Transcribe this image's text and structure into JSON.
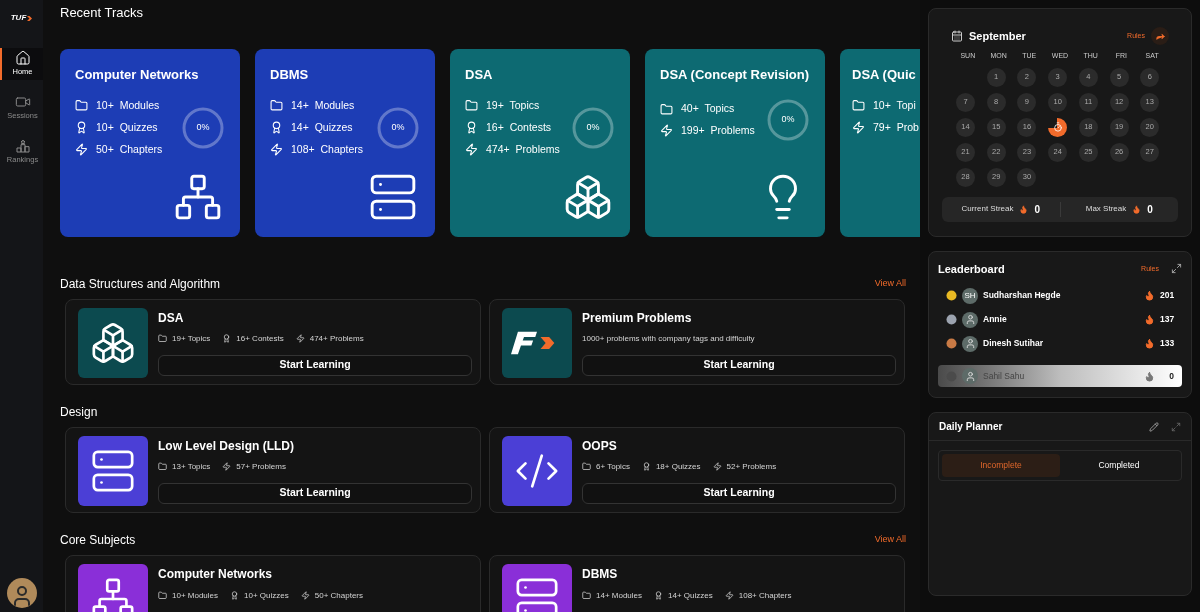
{
  "sidebar": {
    "logo": "TUF",
    "items": [
      {
        "label": "Home",
        "selected": true
      },
      {
        "label": "Sessions",
        "selected": false
      },
      {
        "label": "Rankings",
        "selected": false
      }
    ]
  },
  "recent_tracks": {
    "title": "Recent Tracks",
    "cards": [
      {
        "title": "Computer Networks",
        "color": "#1d3db5",
        "kind": "network",
        "progress": "0%",
        "level": 0,
        "stats": [
          {
            "kind": "folder",
            "value": "10+",
            "label": "Modules"
          },
          {
            "kind": "award",
            "value": "10+",
            "label": "Quizzes"
          },
          {
            "kind": "bolt",
            "value": "50+",
            "label": "Chapters"
          }
        ]
      },
      {
        "title": "DBMS",
        "color": "#1d3db5",
        "kind": "server",
        "progress": "0%",
        "level": 0,
        "stats": [
          {
            "kind": "folder",
            "value": "14+",
            "label": "Modules"
          },
          {
            "kind": "award",
            "value": "14+",
            "label": "Quizzes"
          },
          {
            "kind": "bolt",
            "value": "108+",
            "label": "Chapters"
          }
        ]
      },
      {
        "title": "DSA",
        "color": "#0d6a72",
        "kind": "cubes",
        "progress": "0%",
        "level": 0,
        "stats": [
          {
            "kind": "folder",
            "value": "19+",
            "label": "Topics"
          },
          {
            "kind": "award",
            "value": "16+",
            "label": "Contests"
          },
          {
            "kind": "bolt",
            "value": "474+",
            "label": "Problems"
          }
        ]
      },
      {
        "title": "DSA (Concept Revision)",
        "color": "#0d6a72",
        "kind": "bulb",
        "progress": "0%",
        "level": 0,
        "stats": [
          {
            "kind": "folder",
            "value": "40+",
            "label": "Topics"
          },
          {
            "kind": "bolt",
            "value": "199+",
            "label": "Problems"
          }
        ]
      },
      {
        "title": "DSA (Quic",
        "color": "#0d6a72",
        "stats": [
          {
            "kind": "folder",
            "value": "10+",
            "label": "Topi"
          },
          {
            "kind": "bolt",
            "value": "79+",
            "label": "Prob"
          }
        ]
      }
    ]
  },
  "sections": [
    {
      "title": "Data Structures and Algorithm",
      "link": "View All",
      "cards": [
        {
          "title": "DSA",
          "color": "#0c4a4f",
          "kind": "cubes",
          "stats": [
            {
              "kind": "folder",
              "text": "19+ Topics"
            },
            {
              "kind": "award",
              "text": "16+ Contests"
            },
            {
              "kind": "bolt",
              "text": "474+ Problems"
            }
          ],
          "button": "Start Learning"
        },
        {
          "title": "Premium Problems",
          "color": "#0c4a4f",
          "kind": "logo",
          "description": "1000+ problems with company tags and difficulty",
          "button": "Start Learning"
        }
      ]
    },
    {
      "title": "Design",
      "cards": [
        {
          "title": "Low Level Design (LLD)",
          "color": "#4b3fd6",
          "kind": "server",
          "stats": [
            {
              "kind": "folder",
              "text": "13+ Topics"
            },
            {
              "kind": "bolt",
              "text": "57+ Problems"
            }
          ],
          "button": "Start Learning"
        },
        {
          "title": "OOPS",
          "color": "#4b3fd6",
          "kind": "code",
          "stats": [
            {
              "kind": "folder",
              "text": "6+ Topics"
            },
            {
              "kind": "award",
              "text": "18+ Quizzes"
            },
            {
              "kind": "bolt",
              "text": "52+ Problems"
            }
          ],
          "button": "Start Learning"
        }
      ]
    },
    {
      "title": "Core Subjects",
      "link": "View All",
      "cards": [
        {
          "title": "Computer Networks",
          "color": "#8a2fd8",
          "kind": "network",
          "stats": [
            {
              "kind": "folder",
              "text": "10+ Modules"
            },
            {
              "kind": "award",
              "text": "10+ Quizzes"
            },
            {
              "kind": "bolt",
              "text": "50+ Chapters"
            }
          ]
        },
        {
          "title": "DBMS",
          "color": "#8a2fd8",
          "kind": "server",
          "stats": [
            {
              "kind": "folder",
              "text": "14+ Modules"
            },
            {
              "kind": "award",
              "text": "14+ Quizzes"
            },
            {
              "kind": "bolt",
              "text": "108+ Chapters"
            }
          ]
        }
      ]
    }
  ],
  "calendar": {
    "month": "September",
    "rules": "Rules",
    "weekdays": [
      "SUN",
      "MON",
      "TUE",
      "WED",
      "THU",
      "FRI",
      "SAT"
    ],
    "days": [
      {
        "kind": "blank"
      },
      {
        "kind": "day",
        "label": "1"
      },
      {
        "kind": "day",
        "label": "2"
      },
      {
        "kind": "day",
        "label": "3"
      },
      {
        "kind": "day",
        "label": "4"
      },
      {
        "kind": "day",
        "label": "5"
      },
      {
        "kind": "day",
        "label": "6"
      },
      {
        "kind": "day",
        "label": "7"
      },
      {
        "kind": "day",
        "label": "8"
      },
      {
        "kind": "day",
        "label": "9"
      },
      {
        "kind": "day",
        "label": "10"
      },
      {
        "kind": "day",
        "label": "11"
      },
      {
        "kind": "day",
        "label": "12"
      },
      {
        "kind": "day",
        "label": "13"
      },
      {
        "kind": "day",
        "label": "14"
      },
      {
        "kind": "day",
        "label": "15"
      },
      {
        "kind": "day",
        "label": "16"
      },
      {
        "kind": "today"
      },
      {
        "kind": "day",
        "label": "18"
      },
      {
        "kind": "day",
        "label": "19"
      },
      {
        "kind": "day",
        "label": "20"
      },
      {
        "kind": "day",
        "label": "21"
      },
      {
        "kind": "day",
        "label": "22"
      },
      {
        "kind": "day",
        "label": "23"
      },
      {
        "kind": "day",
        "label": "24"
      },
      {
        "kind": "day",
        "label": "25"
      },
      {
        "kind": "day",
        "label": "26"
      },
      {
        "kind": "day",
        "label": "27"
      },
      {
        "kind": "day",
        "label": "28"
      },
      {
        "kind": "day",
        "label": "29"
      },
      {
        "kind": "day",
        "label": "30"
      }
    ],
    "streaks": [
      {
        "label": "Current Streak",
        "value": "0"
      },
      {
        "label": "Max Streak",
        "value": "0"
      }
    ]
  },
  "leaderboard": {
    "title": "Leaderboard",
    "rules": "Rules",
    "rows": [
      {
        "name": "Sudharshan Hegde",
        "initials": "SH",
        "color": "#e8b923",
        "score": "201",
        "highlighted": false
      },
      {
        "name": "Annie",
        "color": "#9ca3af",
        "score": "137",
        "highlighted": false
      },
      {
        "name": "Dinesh Sutihar",
        "color": "#c97a45",
        "score": "133",
        "highlighted": false
      },
      {
        "name": "Sahil Sahu",
        "color": "#4b4b4b",
        "score": "0",
        "highlighted": true
      }
    ]
  },
  "daily_planner": {
    "title": "Daily Planner",
    "tabs": [
      {
        "label": "Incomplete",
        "selected": true
      },
      {
        "label": "Completed",
        "selected": false
      }
    ]
  }
}
